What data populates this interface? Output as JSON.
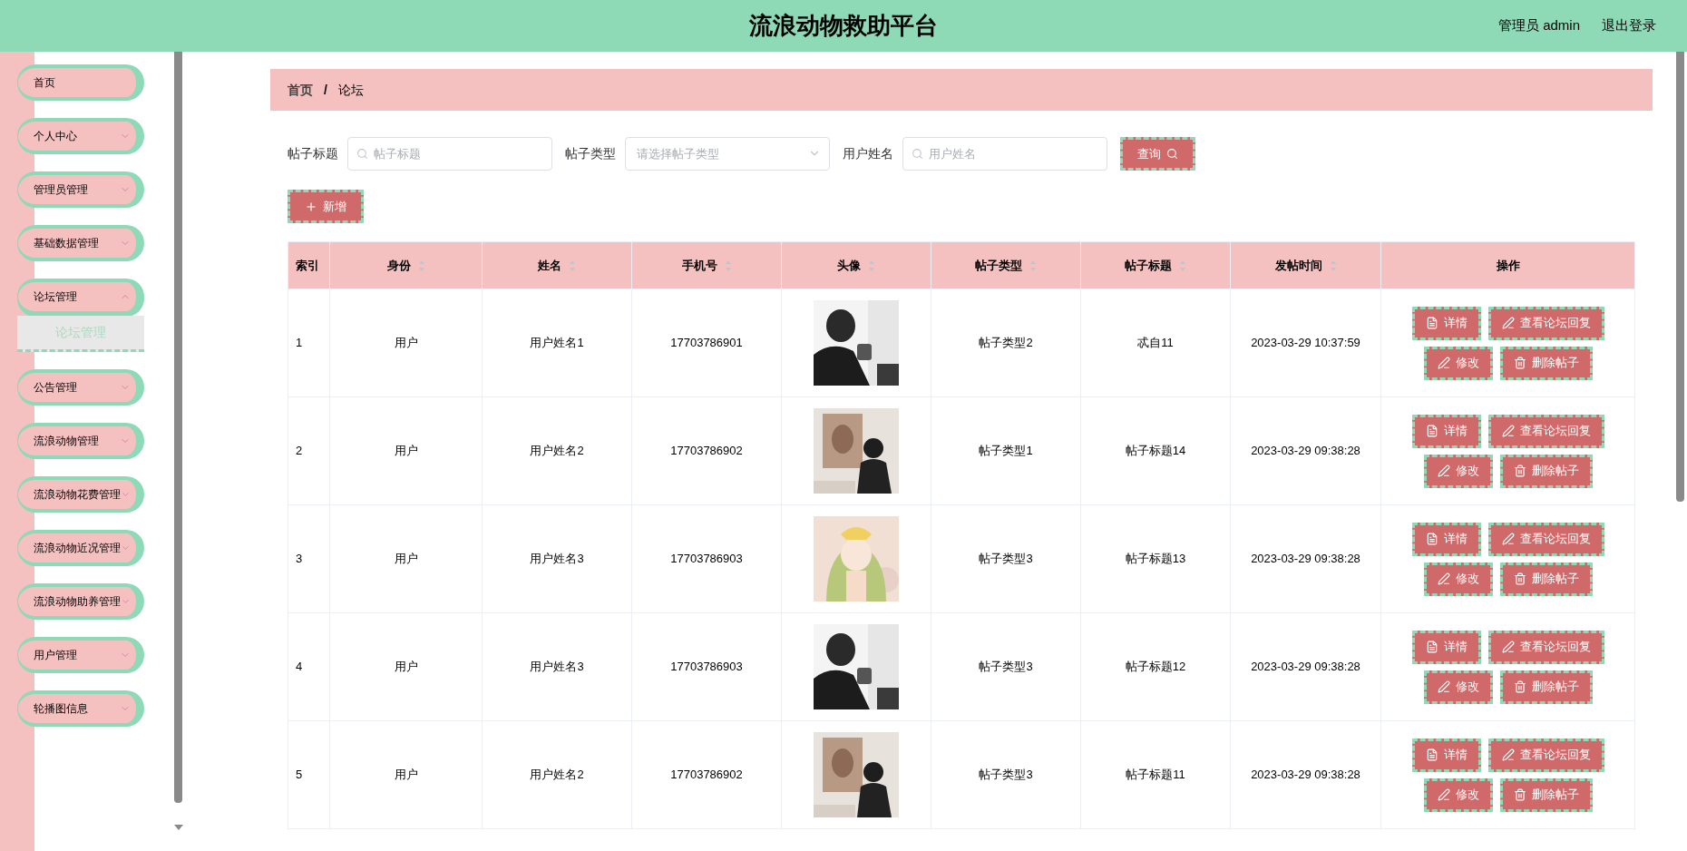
{
  "header": {
    "title": "流浪动物救助平台",
    "user": "管理员 admin",
    "logout": "退出登录"
  },
  "sidebar": {
    "items": [
      {
        "label": "首页",
        "has_children": false,
        "expanded": false
      },
      {
        "label": "个人中心",
        "has_children": true,
        "expanded": false
      },
      {
        "label": "管理员管理",
        "has_children": true,
        "expanded": false
      },
      {
        "label": "基础数据管理",
        "has_children": true,
        "expanded": false
      },
      {
        "label": "论坛管理",
        "has_children": true,
        "expanded": true,
        "children": [
          {
            "label": "论坛管理",
            "selected": true
          }
        ]
      },
      {
        "label": "公告管理",
        "has_children": true,
        "expanded": false
      },
      {
        "label": "流浪动物管理",
        "has_children": true,
        "expanded": false
      },
      {
        "label": "流浪动物花费管理",
        "has_children": true,
        "expanded": false
      },
      {
        "label": "流浪动物近况管理",
        "has_children": true,
        "expanded": false
      },
      {
        "label": "流浪动物助养管理",
        "has_children": true,
        "expanded": false
      },
      {
        "label": "用户管理",
        "has_children": true,
        "expanded": false
      },
      {
        "label": "轮播图信息",
        "has_children": true,
        "expanded": false
      }
    ]
  },
  "breadcrumb": {
    "items": [
      "首页",
      "论坛"
    ],
    "separator": "/"
  },
  "search": {
    "fields": [
      {
        "label": "帖子标题",
        "kind": "text",
        "placeholder": "帖子标题"
      },
      {
        "label": "帖子类型",
        "kind": "select",
        "placeholder": "请选择帖子类型"
      },
      {
        "label": "用户姓名",
        "kind": "text",
        "placeholder": "用户姓名"
      }
    ],
    "button": "查询"
  },
  "add_button": "新增",
  "table": {
    "columns": [
      {
        "label": "索引",
        "sortable": false
      },
      {
        "label": "身份",
        "sortable": true
      },
      {
        "label": "姓名",
        "sortable": true
      },
      {
        "label": "手机号",
        "sortable": true
      },
      {
        "label": "头像",
        "sortable": true
      },
      {
        "label": "帖子类型",
        "sortable": true
      },
      {
        "label": "帖子标题",
        "sortable": true
      },
      {
        "label": "发帖时间",
        "sortable": true
      },
      {
        "label": "操作",
        "sortable": false
      }
    ],
    "rows": [
      {
        "index": "1",
        "role": "用户",
        "name": "用户姓名1",
        "phone": "17703786901",
        "avatar": {
          "kind": "picture"
        },
        "type": "帖子类型2",
        "title": "忒自11",
        "time": "2023-03-29 10:37:59",
        "actions": [
          {
            "label": "详情",
            "kind": "detail"
          },
          {
            "label": "查看论坛回复",
            "kind": "reply"
          },
          {
            "label": "修改",
            "kind": "edit"
          },
          {
            "label": "删除帖子",
            "kind": "delete"
          }
        ]
      },
      {
        "index": "2",
        "role": "用户",
        "name": "用户姓名2",
        "phone": "17703786902",
        "avatar": {
          "kind": "picture"
        },
        "type": "帖子类型1",
        "title": "帖子标题14",
        "time": "2023-03-29 09:38:28",
        "actions": [
          {
            "label": "详情",
            "kind": "detail"
          },
          {
            "label": "查看论坛回复",
            "kind": "reply"
          },
          {
            "label": "修改",
            "kind": "edit"
          },
          {
            "label": "删除帖子",
            "kind": "delete"
          }
        ]
      },
      {
        "index": "3",
        "role": "用户",
        "name": "用户姓名3",
        "phone": "17703786903",
        "avatar": {
          "kind": "picture"
        },
        "type": "帖子类型3",
        "title": "帖子标题13",
        "time": "2023-03-29 09:38:28",
        "actions": [
          {
            "label": "详情",
            "kind": "detail"
          },
          {
            "label": "查看论坛回复",
            "kind": "reply"
          },
          {
            "label": "修改",
            "kind": "edit"
          },
          {
            "label": "删除帖子",
            "kind": "delete"
          }
        ]
      },
      {
        "index": "4",
        "role": "用户",
        "name": "用户姓名3",
        "phone": "17703786903",
        "avatar": {
          "kind": "picture"
        },
        "type": "帖子类型3",
        "title": "帖子标题12",
        "time": "2023-03-29 09:38:28",
        "actions": [
          {
            "label": "详情",
            "kind": "detail"
          },
          {
            "label": "查看论坛回复",
            "kind": "reply"
          },
          {
            "label": "修改",
            "kind": "edit"
          },
          {
            "label": "删除帖子",
            "kind": "delete"
          }
        ]
      },
      {
        "index": "5",
        "role": "用户",
        "name": "用户姓名2",
        "phone": "17703786902",
        "avatar": {
          "kind": "picture"
        },
        "type": "帖子类型3",
        "title": "帖子标题11",
        "time": "2023-03-29 09:38:28",
        "actions": [
          {
            "label": "详情",
            "kind": "detail"
          },
          {
            "label": "查看论坛回复",
            "kind": "reply"
          },
          {
            "label": "修改",
            "kind": "edit"
          },
          {
            "label": "删除帖子",
            "kind": "delete"
          }
        ]
      }
    ]
  }
}
